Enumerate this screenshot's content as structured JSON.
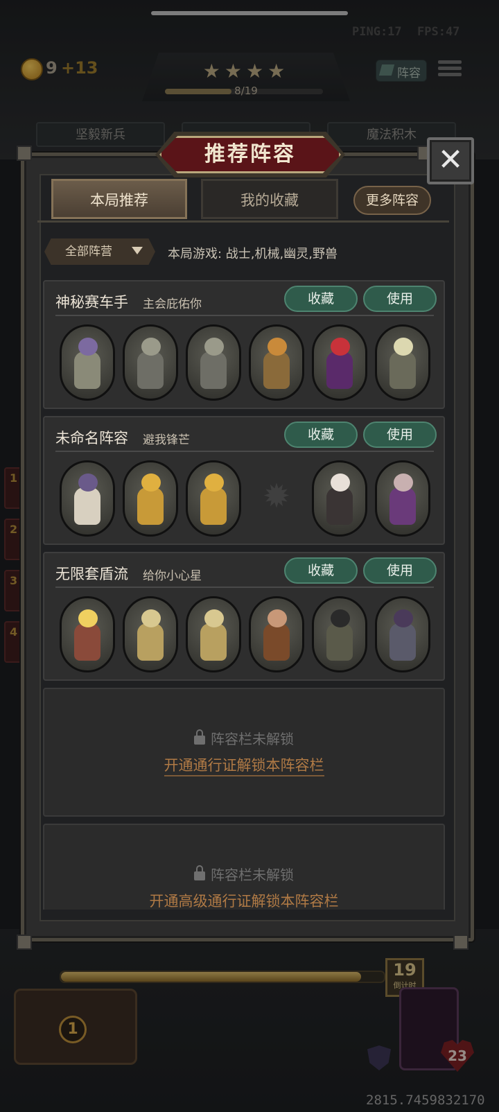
{
  "hud": {
    "ping": "PING:17",
    "fps": "FPS:47",
    "coins": "9",
    "coins_bonus": "+13",
    "stars": "★★★★",
    "xp_text": "8/19",
    "xp_fraction": 0.42,
    "lineup_button": "阵容",
    "shop_tabs": [
      "坚毅新兵",
      "",
      "魔法积木"
    ],
    "side_numbers": [
      "1",
      "2",
      "3",
      "4"
    ],
    "timer_value": "19",
    "timer_label": "倒计时",
    "timer_fraction": 0.93,
    "chest_count": "1",
    "health": "23",
    "coordinates": "2815.7459832170"
  },
  "modal": {
    "title": "推荐阵容",
    "close_icon": "close-icon",
    "tabs": {
      "active": "本局推荐",
      "inactive": "我的收藏"
    },
    "more_button": "更多阵容",
    "faction_filter": "全部阵营",
    "game_info": "本局游戏: 战士,机械,幽灵,野兽",
    "card_buttons": {
      "favorite": "收藏",
      "use": "使用"
    },
    "lineups": [
      {
        "name": "神秘赛车手",
        "subtitle": "主会庇佑你",
        "units": [
          {
            "head": "#7c6aa0",
            "body": "#8a8a78"
          },
          {
            "head": "#9a9a8a",
            "body": "#6e6e66"
          },
          {
            "head": "#9a9a8a",
            "body": "#6e6e66"
          },
          {
            "head": "#c98a3a",
            "body": "#8a6a3a"
          },
          {
            "head": "#c8323a",
            "body": "#5a2a6a"
          },
          {
            "head": "#dcd8b0",
            "body": "#6a6a5a"
          }
        ]
      },
      {
        "name": "未命名阵容",
        "subtitle": "避我锋芒",
        "units": [
          {
            "head": "#6a5a8a",
            "body": "#d8d0c0"
          },
          {
            "head": "#e0b040",
            "body": "#c89a38"
          },
          {
            "head": "#e0b040",
            "body": "#c89a38"
          },
          {
            "empty": true
          },
          {
            "head": "#e8e0d8",
            "body": "#3a3434"
          },
          {
            "head": "#c8b0b0",
            "body": "#6a3a7a"
          }
        ]
      },
      {
        "name": "无限套盾流",
        "subtitle": "给你小心星",
        "units": [
          {
            "head": "#f0d060",
            "body": "#8a4a3a"
          },
          {
            "head": "#d8c890",
            "body": "#b8a060"
          },
          {
            "head": "#d8c890",
            "body": "#b8a060"
          },
          {
            "head": "#c89878",
            "body": "#7a4a2a"
          },
          {
            "head": "#2a2a2a",
            "body": "#5a5a4a"
          },
          {
            "head": "#4a3a5a",
            "body": "#5a5a6a"
          }
        ]
      }
    ],
    "locked_slots": [
      {
        "label": "阵容栏未解锁",
        "link": "开通通行证解锁本阵容栏"
      },
      {
        "label": "阵容栏未解锁",
        "link": "开通高级通行证解锁本阵容栏"
      }
    ]
  }
}
